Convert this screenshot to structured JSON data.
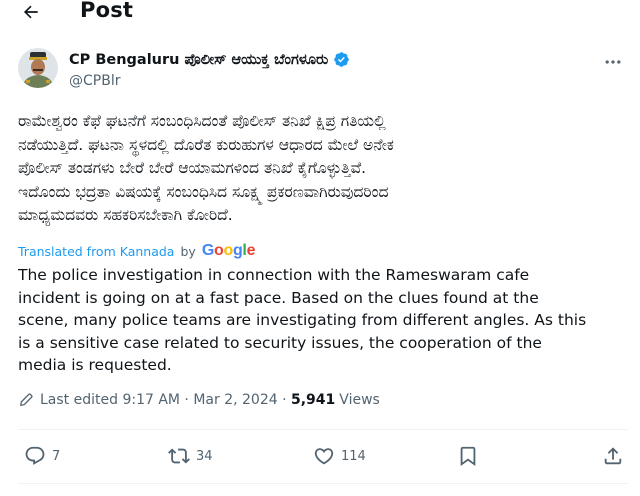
{
  "header": {
    "title": "Post"
  },
  "author": {
    "name": "CP Bengaluru ಪೊಲೀಸ್ ಆಯುಕ್ತ ಬೆಂಗಳೂರು",
    "handle": "@CPBlr"
  },
  "post": {
    "original_lines": [
      "ರಾಮೇಶ್ವರಂ ಕೆಫೆ ಘಟನೆಗೆ ಸಂಬಂಧಿಸಿದಂತೆ ಪೊಲೀಸ್ ತನಿಖೆ ಕ್ಷಿಪ್ರ ಗತಿಯಲ್ಲಿ",
      "ನಡೆಯುತ್ತಿದೆ. ಘಟನಾ ಸ್ಥಳದಲ್ಲಿ ದೊರೆತ ಕುರುಹುಗಳ ಆಧಾರದ ಮೇಲೆ ಅನೇಕ",
      "ಪೊಲೀಸ್ ತಂಡಗಳು ಬೇರೆ ಬೇರೆ ಆಯಾಮಗಳಿಂದ ತನಿಖೆ ಕೈಗೊಳ್ಳುತ್ತಿವೆ.",
      "ಇದೊಂದು ಭದ್ರತಾ ವಿಷಯಕ್ಕೆ ಸಂಬಂಧಿಸಿದ ಸೂಕ್ಷ್ಮ ಪ್ರಕರಣವಾಗಿರುವುದರಿಂದ",
      "ಮಾಧ್ಯಮದವರು ಸಹಕರಿಸಬೇಕಾಗಿ ಕೋರಿದೆ."
    ],
    "translated_label": "Translated from Kannada",
    "translated_by": "by",
    "google": [
      "G",
      "o",
      "o",
      "g",
      "l",
      "e"
    ],
    "translation_lines": [
      "The police investigation in connection with the Rameswaram cafe",
      "incident is going on at a fast pace. Based on the clues found at the",
      "scene, many police teams are investigating from different angles. As this",
      "is a sensitive case related to security issues, the cooperation of the",
      "media is requested."
    ],
    "meta": {
      "edited": "Last edited 9:17 AM · Mar 2, 2024",
      "separator": " · ",
      "views_count": "5,941",
      "views_label": "Views"
    }
  },
  "actions": {
    "replies": "7",
    "reposts": "34",
    "likes": "114"
  },
  "colors": {
    "text": "#0f1419",
    "secondary": "#536471",
    "link": "#1d9bf0",
    "verified": "#1d9bf0",
    "divider": "#eff3f4",
    "google": [
      "#4285f4",
      "#ea4335",
      "#fbbc05",
      "#4285f4",
      "#34a853",
      "#ea4335"
    ]
  },
  "icons": {
    "back": "arrow-left-icon",
    "verified": "verified-badge-icon",
    "more": "more-horizontal-icon",
    "edit": "pencil-icon",
    "reply": "reply-icon",
    "repost": "repost-icon",
    "like": "heart-icon",
    "bookmark": "bookmark-icon",
    "share": "share-icon"
  }
}
